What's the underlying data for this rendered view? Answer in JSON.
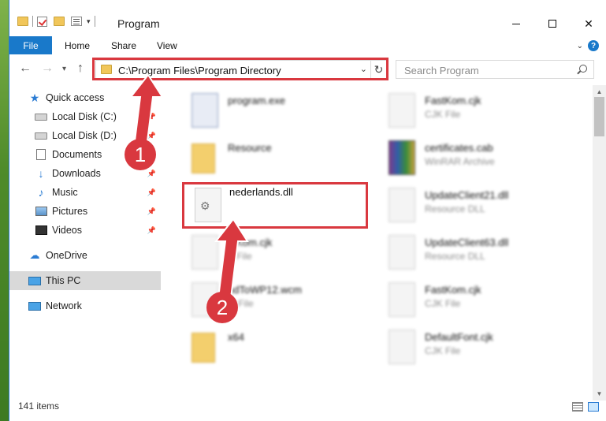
{
  "window": {
    "title": "Program"
  },
  "ribbon": {
    "file": "File",
    "home": "Home",
    "share": "Share",
    "view": "View"
  },
  "nav": {
    "address": "C:\\Program Files\\Program Directory",
    "search_placeholder": "Search Program"
  },
  "sidebar": {
    "items": [
      {
        "label": "Quick access",
        "icon": "star-icon"
      },
      {
        "label": "Local Disk (C:)",
        "icon": "drive-icon",
        "pinned": true
      },
      {
        "label": "Local Disk (D:)",
        "icon": "drive-icon",
        "pinned": true
      },
      {
        "label": "Documents",
        "icon": "documents-icon",
        "pinned": true
      },
      {
        "label": "Downloads",
        "icon": "download-icon",
        "pinned": true
      },
      {
        "label": "Music",
        "icon": "music-icon",
        "pinned": true
      },
      {
        "label": "Pictures",
        "icon": "pictures-icon",
        "pinned": true
      },
      {
        "label": "Videos",
        "icon": "videos-icon",
        "pinned": true
      },
      {
        "label": "OneDrive",
        "icon": "cloud-icon"
      },
      {
        "label": "This PC",
        "icon": "computer-icon",
        "selected": true
      },
      {
        "label": "Network",
        "icon": "network-icon"
      }
    ]
  },
  "files": [
    {
      "name": "program.exe",
      "type": ""
    },
    {
      "name": "FastKom.cjk",
      "type": "CJK File"
    },
    {
      "name": "Resource",
      "type": ""
    },
    {
      "name": "certificates.cab",
      "type": "WinRAR Archive"
    },
    {
      "name": "nederlands.dll",
      "type": ""
    },
    {
      "name": "UpdateClient21.dll",
      "type": "Resource DLL"
    },
    {
      "name": "stKom.cjk",
      "type": "K File"
    },
    {
      "name": "UpdateClient63.dll",
      "type": "Resource DLL"
    },
    {
      "name": "ndToWP12.wcm",
      "type": "M File"
    },
    {
      "name": "FastKom.cjk",
      "type": "CJK File"
    },
    {
      "name": "x64",
      "type": ""
    },
    {
      "name": "DefaultFont.cjk",
      "type": "CJK File"
    }
  ],
  "status": {
    "items": "141 items"
  },
  "annotations": {
    "step1": "1",
    "step2": "2"
  },
  "colors": {
    "accent": "#1979ca",
    "highlight": "#d9383f",
    "selected": "#d9d9d9"
  }
}
